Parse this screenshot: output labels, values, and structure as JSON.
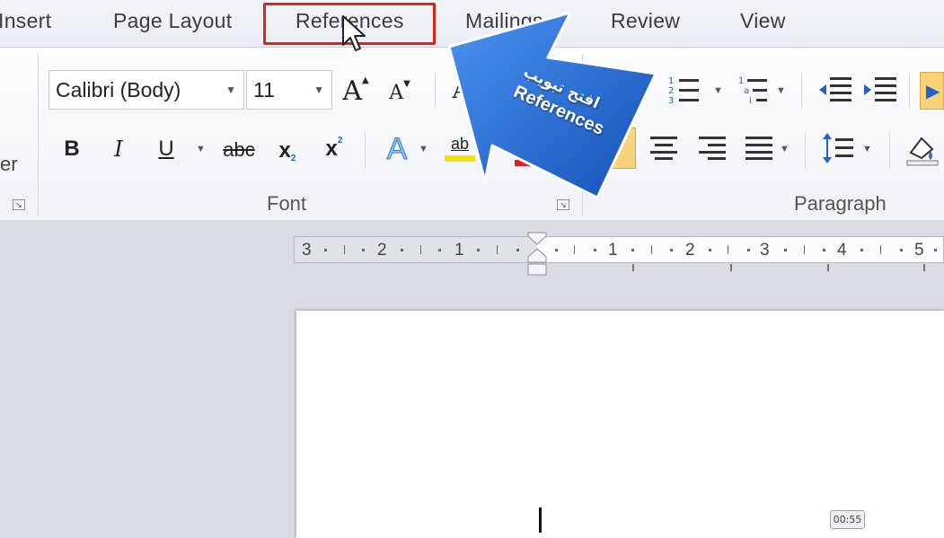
{
  "tabs": [
    {
      "label": "Insert"
    },
    {
      "label": "Page Layout"
    },
    {
      "label": "References"
    },
    {
      "label": "Mailings"
    },
    {
      "label": "Review"
    },
    {
      "label": "View"
    }
  ],
  "left_partial_label": "er",
  "font": {
    "family": "Calibri (Body)",
    "size": "11",
    "group_label": "Font"
  },
  "paragraph": {
    "group_label": "Paragraph"
  },
  "buttons": {
    "bold": "B",
    "italic": "I",
    "underline": "U",
    "strikethrough": "abc",
    "subscript": "x",
    "superscript": "x",
    "grow_font": "A",
    "shrink_font": "A",
    "font_color": "A",
    "highlight": "ab"
  },
  "ruler": {
    "labels": [
      "3",
      "2",
      "1",
      "1",
      "2",
      "3",
      "4",
      "5"
    ]
  },
  "callout": {
    "arabic": "افتح تبويب",
    "english": "References"
  },
  "video": {
    "timestamp": "00:55"
  },
  "colors": {
    "highlight_box": "#d8261c",
    "callout_blue": "#1f63c6",
    "highlight_yellow": "#f3e300",
    "font_red": "#e02020",
    "selected_button": "#f8d37a"
  }
}
